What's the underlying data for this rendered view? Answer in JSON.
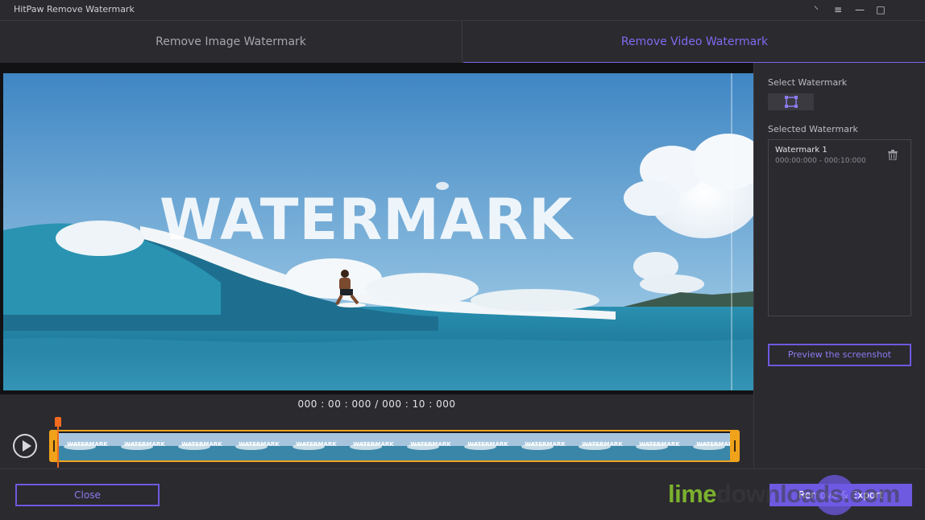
{
  "app": {
    "title": "HitPaw Remove Watermark"
  },
  "window_controls": {
    "pin_glyph": "⸌",
    "menu_glyph": "≡",
    "minimize_glyph": "—",
    "maximize_glyph": "□"
  },
  "tabs": [
    {
      "label": "Remove Image Watermark",
      "active": false
    },
    {
      "label": "Remove Video Watermark",
      "active": true
    }
  ],
  "video": {
    "watermark_text": "WATERMARK"
  },
  "timeline": {
    "time_readout": "000 : 00 : 000 / 000 : 10 : 000",
    "frame_label": "WATERMARK",
    "frame_count": 12
  },
  "sidebar": {
    "select_watermark_label": "Select Watermark",
    "selected_watermark_label": "Selected Watermark",
    "watermarks": [
      {
        "name": "Watermark 1",
        "time_range": "000:00:000 - 000:10:000"
      }
    ],
    "preview_button": "Preview the screenshot"
  },
  "footer": {
    "close_button": "Close",
    "export_button": "Remove & Export"
  },
  "overlay": {
    "logo_lime": "lime",
    "logo_rest": "downloads.com"
  },
  "colors": {
    "accent": "#6d5ae0",
    "playhead": "#f26b1f",
    "trim": "#f0a21b"
  }
}
